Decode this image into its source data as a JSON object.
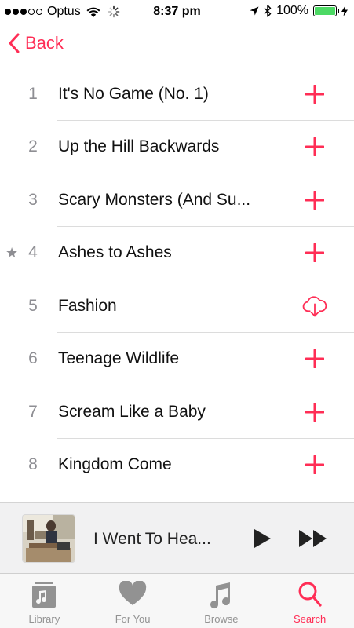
{
  "status_bar": {
    "carrier": "Optus",
    "time": "8:37 pm",
    "battery_percent": "100%",
    "signal_bars_filled": 3,
    "signal_bars_total": 5,
    "battery_level": 1.0
  },
  "nav": {
    "back_label": "Back"
  },
  "tracks": [
    {
      "num": "1",
      "title": "It's No Game (No. 1)",
      "action": "add",
      "starred": false
    },
    {
      "num": "2",
      "title": "Up the Hill Backwards",
      "action": "add",
      "starred": false
    },
    {
      "num": "3",
      "title": "Scary Monsters (And Su...",
      "action": "add",
      "starred": false
    },
    {
      "num": "4",
      "title": "Ashes to Ashes",
      "action": "add",
      "starred": true,
      "star": "★"
    },
    {
      "num": "5",
      "title": "Fashion",
      "action": "download",
      "starred": false
    },
    {
      "num": "6",
      "title": "Teenage Wildlife",
      "action": "add",
      "starred": false
    },
    {
      "num": "7",
      "title": "Scream Like a Baby",
      "action": "add",
      "starred": false
    },
    {
      "num": "8",
      "title": "Kingdom Come",
      "action": "add",
      "starred": false
    }
  ],
  "mini_player": {
    "title": "I Went To Hea..."
  },
  "tabs": [
    {
      "label": "Library",
      "icon": "library-icon",
      "active": false
    },
    {
      "label": "For You",
      "icon": "heart-icon",
      "active": false
    },
    {
      "label": "Browse",
      "icon": "music-note-icon",
      "active": false
    },
    {
      "label": "Search",
      "icon": "search-icon",
      "active": true
    }
  ],
  "colors": {
    "accent": "#ff2d55",
    "battery": "#4cd964",
    "secondary_text": "#8e8e93",
    "tab_inactive": "#929292"
  }
}
